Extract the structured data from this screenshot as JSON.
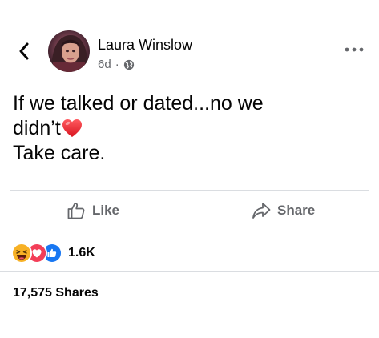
{
  "header": {
    "author_name": "Laura Winslow",
    "timestamp": "6d",
    "separator": "·",
    "audience_icon": "globe-icon",
    "back_icon": "chevron-left-icon",
    "more_icon": "more-horizontal-icon"
  },
  "post": {
    "lines": [
      "If we talked or dated...no we",
      "didn’t",
      "Take care."
    ],
    "emoji": "red-heart"
  },
  "actions": {
    "like_label": "Like",
    "share_label": "Share"
  },
  "reactions": {
    "types": [
      "haha",
      "love",
      "like"
    ],
    "count": "1.6K"
  },
  "shares": {
    "label": "17,575 Shares"
  },
  "colors": {
    "text": "#050505",
    "secondary": "#65676b",
    "divider": "#dadde1",
    "like_blue": "#1877f2",
    "love_red": "#f33e58",
    "haha_yellow": "#f7b125"
  }
}
